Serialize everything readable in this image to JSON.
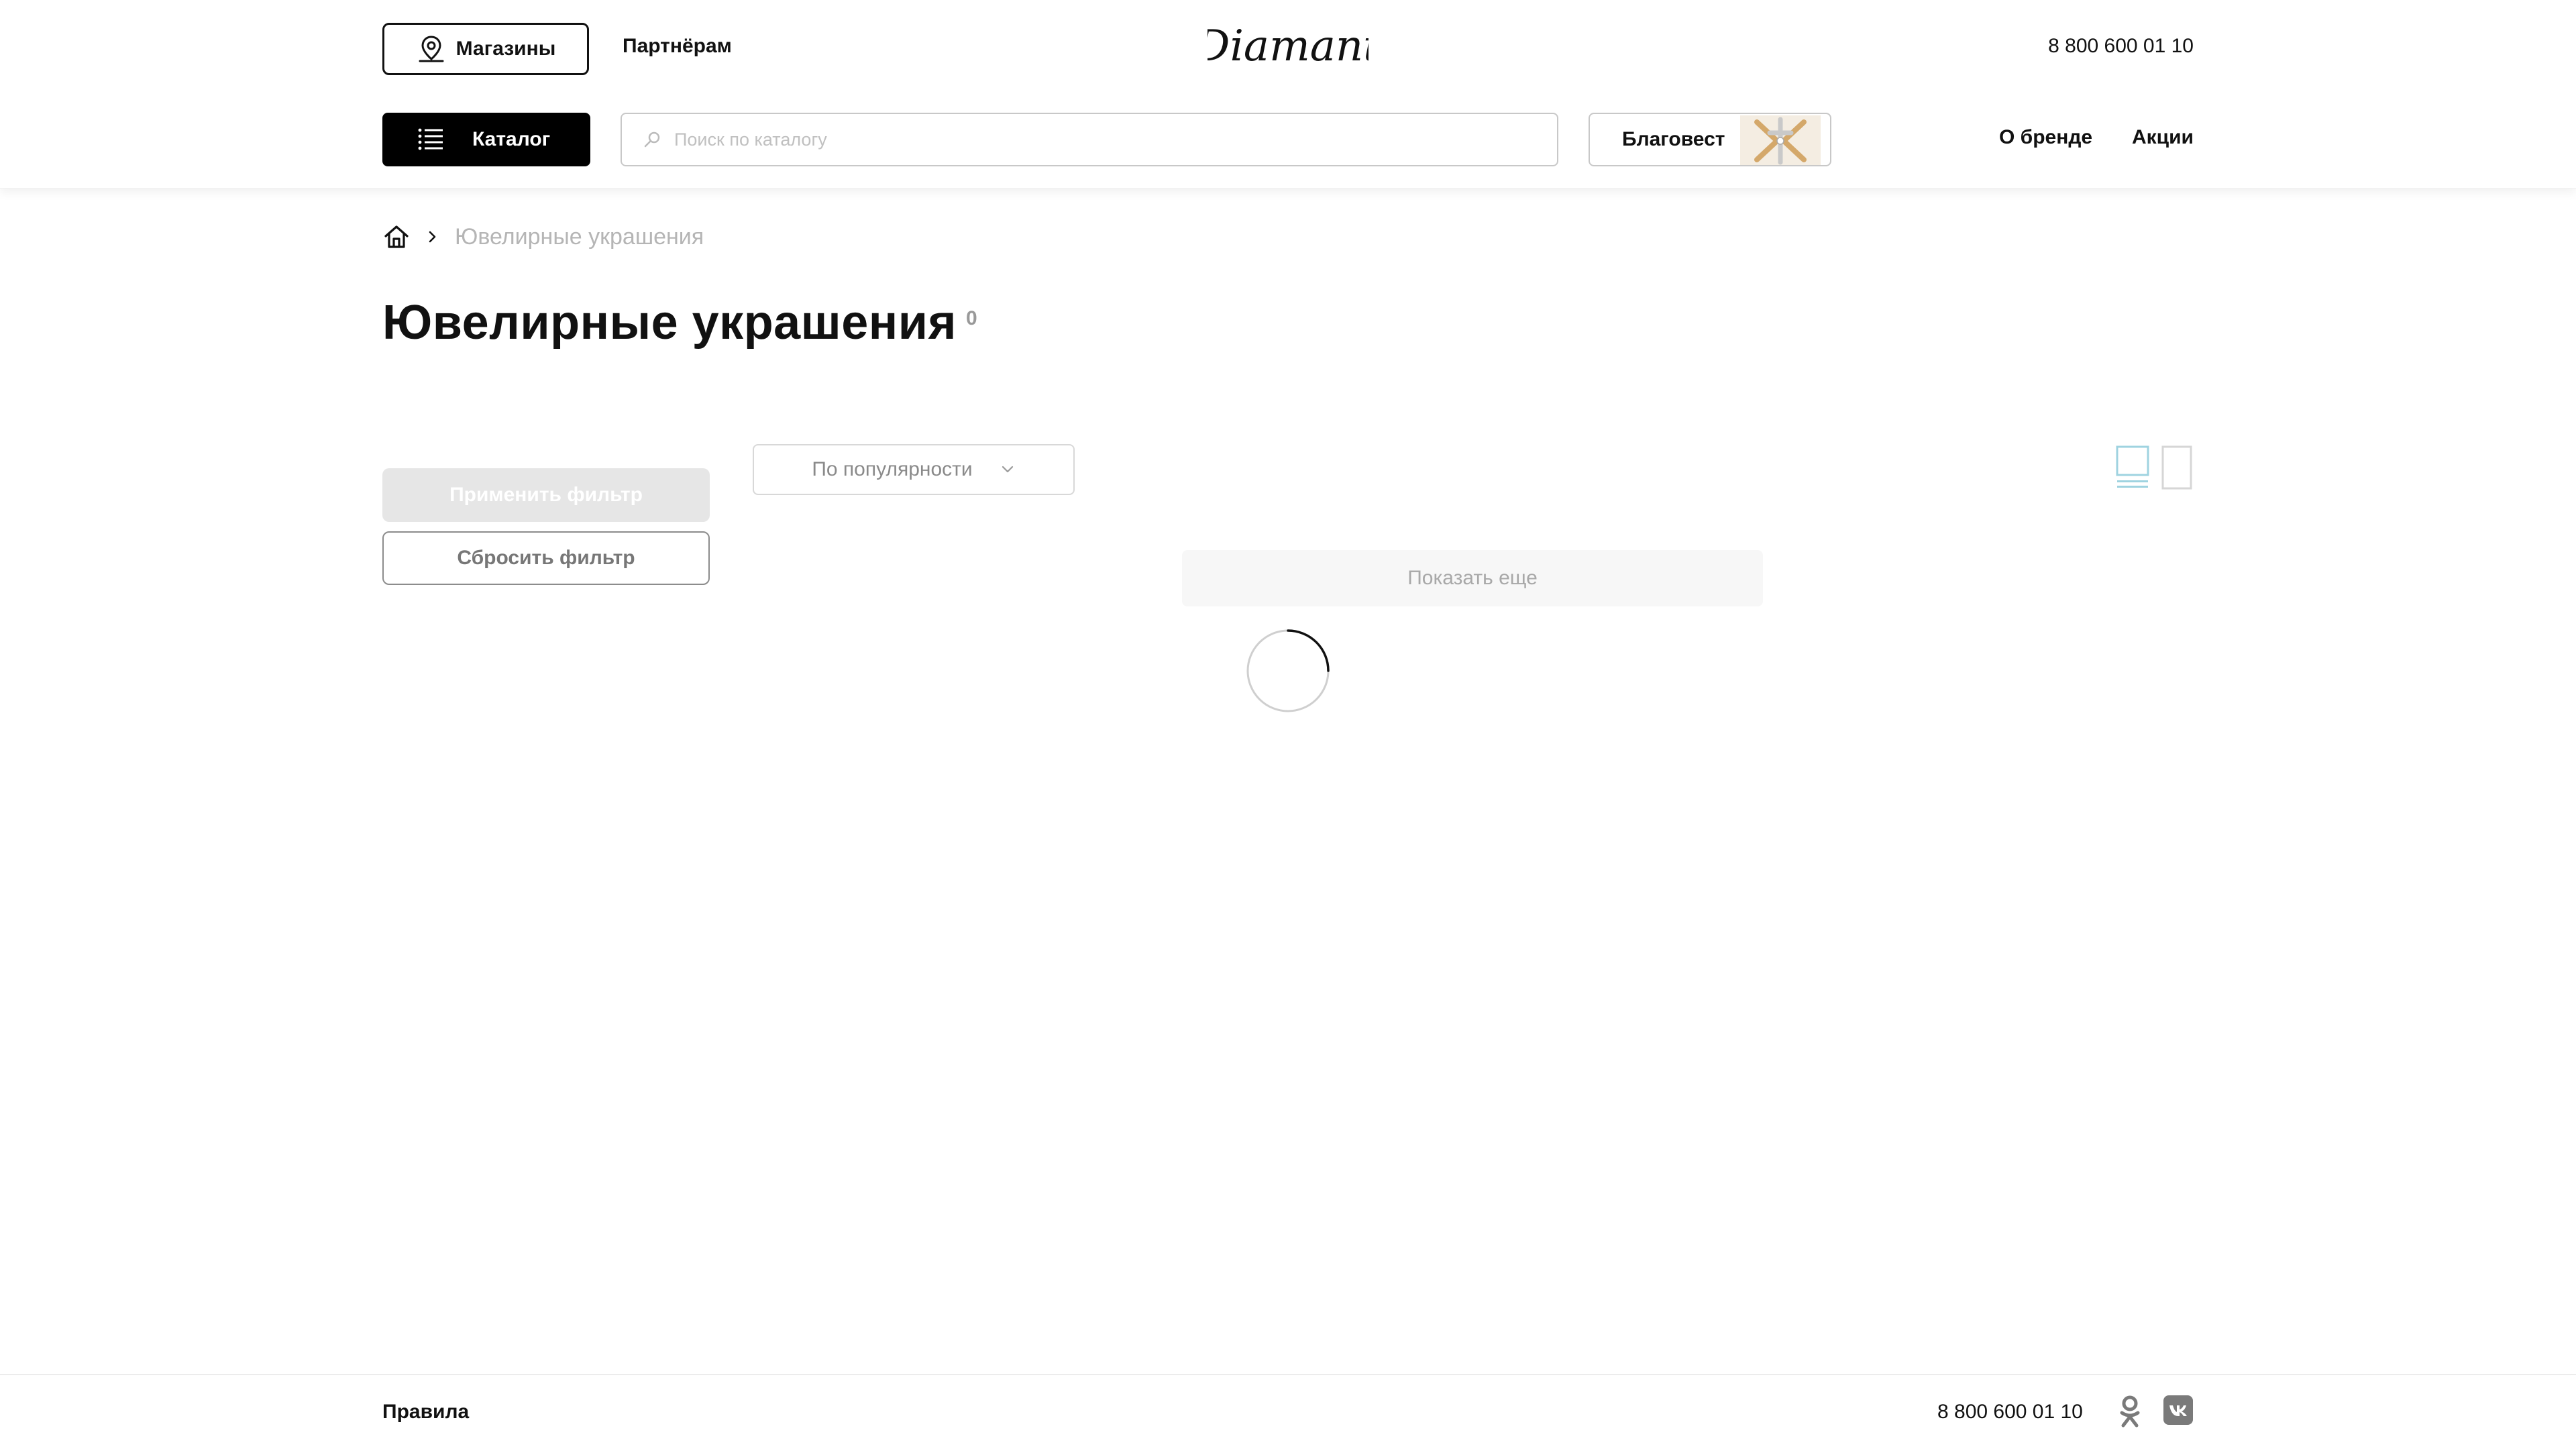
{
  "header": {
    "stores_label": "Магазины",
    "partners_label": "Партнёрам",
    "logo_text": "Diamant",
    "phone": "8 800 600 01 10",
    "catalog_label": "Каталог",
    "search": {
      "placeholder": "Поиск по каталогу",
      "value": ""
    },
    "promo_banner_label": "Благовест",
    "nav": {
      "about_label": "О бренде",
      "promo_label": "Акции"
    }
  },
  "breadcrumb": {
    "items": [
      "Ювелирные украшения"
    ]
  },
  "main": {
    "title": "Ювелирные украшения",
    "product_count": "0",
    "filter": {
      "apply_label": "Применить фильтр",
      "reset_label": "Сбросить фильтр"
    },
    "sort": {
      "selected": "По популярности"
    },
    "load_more_label": "Показать еще"
  },
  "footer": {
    "rules_label": "Правила",
    "phone": "8 800 600 01 10"
  },
  "icons": {
    "stores": "map-pin-icon",
    "catalog": "menu-list-icon",
    "search": "search-icon",
    "home": "home-icon",
    "breadcrumb_separator": "chevron-right-icon",
    "sort": "chevron-down-icon",
    "view_grid": "grid-view-icon",
    "view_single": "single-view-icon",
    "loading": "loading-spinner-icon",
    "social_ok": "odnoklassniki-icon",
    "social_vk": "vk-icon"
  },
  "colors": {
    "primary": "#000000",
    "active_view_icon": "#9fd3e0",
    "inactive_view_icon": "#d6d6d6",
    "disabled_button": "#e6e6e6",
    "muted_text": "#b5b5b5"
  }
}
